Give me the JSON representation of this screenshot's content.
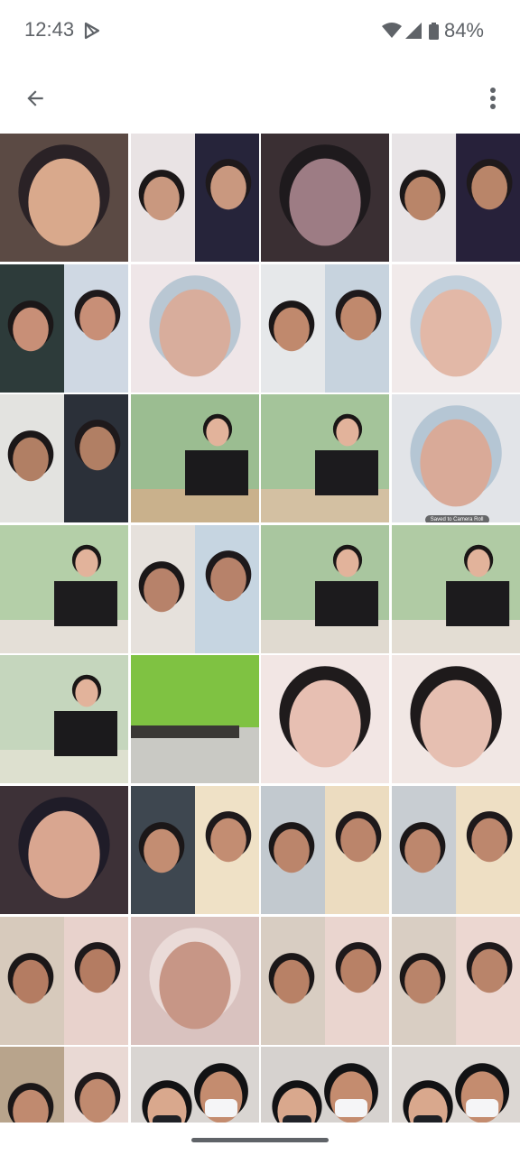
{
  "status_bar": {
    "time": "12:43",
    "battery": "84%",
    "icons": [
      "play-store-icon",
      "wifi-icon",
      "signal-icon",
      "battery-icon"
    ]
  },
  "app_bar": {
    "icons": [
      "arrow-back-icon",
      "more-vert-icon"
    ]
  },
  "photo_grid": {
    "columns": 4,
    "tiles": [
      {
        "desc": "selfie-glasses",
        "colors": [
          "#5b4a44",
          "#d9a98c",
          "#2a2226"
        ]
      },
      {
        "desc": "video-call-split",
        "colors": [
          "#e9e3e4",
          "#c9987f",
          "#26243a"
        ]
      },
      {
        "desc": "close-up-dark",
        "colors": [
          "#3a2f33",
          "#9d7c84",
          "#1e1a1d"
        ]
      },
      {
        "desc": "video-call-split",
        "colors": [
          "#e8e4e6",
          "#b98569",
          "#27213a"
        ]
      },
      {
        "desc": "video-call-split",
        "colors": [
          "#2d3b3a",
          "#c88f77",
          "#cfd8e3"
        ]
      },
      {
        "desc": "close-up-face",
        "colors": [
          "#efe6e8",
          "#d8ad9c",
          "#b9c7d3"
        ]
      },
      {
        "desc": "video-call-split",
        "colors": [
          "#e6e8ea",
          "#c0896d",
          "#c7d3de"
        ]
      },
      {
        "desc": "close-up-face",
        "colors": [
          "#f1eaea",
          "#e2b8a7",
          "#c2d0dc"
        ]
      },
      {
        "desc": "video-call-split",
        "colors": [
          "#e3e3e0",
          "#b17f64",
          "#2b3039"
        ]
      },
      {
        "desc": "restaurant",
        "colors": [
          "#9bbd91",
          "#1b1a1c",
          "#c9b18c"
        ]
      },
      {
        "desc": "restaurant",
        "colors": [
          "#a4c49a",
          "#1c1b1e",
          "#d3c0a2"
        ]
      },
      {
        "desc": "video-call-glasses",
        "colors": [
          "#e2e4e8",
          "#d9aa98",
          "#b5c6d4"
        ]
      },
      {
        "desc": "restaurant",
        "colors": [
          "#b4cfa8",
          "#1d1c1e",
          "#e4dfd7"
        ]
      },
      {
        "desc": "video-call-split",
        "colors": [
          "#e6e1dc",
          "#b7826a",
          "#c6d5e1"
        ]
      },
      {
        "desc": "restaurant",
        "colors": [
          "#a9c69f",
          "#1c1b1d",
          "#e0dad0"
        ]
      },
      {
        "desc": "restaurant",
        "colors": [
          "#b0cba4",
          "#1c1b1d",
          "#e3ddd3"
        ]
      },
      {
        "desc": "restaurant",
        "colors": [
          "#c5d6bd",
          "#1b1a1c",
          "#dde0cf"
        ]
      },
      {
        "desc": "green-screen-room",
        "colors": [
          "#7fc242",
          "#3a3835",
          "#c9c9c4"
        ]
      },
      {
        "desc": "peace-sign-selfie",
        "colors": [
          "#f2e6e4",
          "#e7bfb2",
          "#1f1b1c"
        ]
      },
      {
        "desc": "peace-sign-selfie",
        "colors": [
          "#f1e7e4",
          "#e6bfb1",
          "#1e1a1b"
        ]
      },
      {
        "desc": "close-up-face",
        "colors": [
          "#3d3137",
          "#d9a690",
          "#1f1c28"
        ]
      },
      {
        "desc": "video-call-split",
        "colors": [
          "#3e4750",
          "#c38d72",
          "#efe1c6"
        ]
      },
      {
        "desc": "video-call-split",
        "colors": [
          "#c2c9cf",
          "#bb856b",
          "#ecdcc0"
        ]
      },
      {
        "desc": "video-call-split",
        "colors": [
          "#c8cdd2",
          "#bd876d",
          "#eedfc4"
        ]
      },
      {
        "desc": "video-call-split",
        "colors": [
          "#d7cabc",
          "#b47c62",
          "#e8d2cc"
        ]
      },
      {
        "desc": "close-up-eye",
        "colors": [
          "#d9c2bf",
          "#c79686",
          "#eadbd8"
        ]
      },
      {
        "desc": "video-call-split",
        "colors": [
          "#d8cdc2",
          "#b88166",
          "#ead5cf"
        ]
      },
      {
        "desc": "video-call-split",
        "colors": [
          "#d9cec3",
          "#b9846a",
          "#ecd7d1"
        ]
      },
      {
        "desc": "video-call-split",
        "colors": [
          "#b8a48c",
          "#c08a6f",
          "#e9d9d4"
        ]
      },
      {
        "desc": "masked-couple",
        "colors": [
          "#d9d5d2",
          "#1f2126",
          "#f3e6a6"
        ]
      },
      {
        "desc": "masked-couple",
        "colors": [
          "#d6d2cf",
          "#202228",
          "#f3e7a8"
        ]
      },
      {
        "desc": "masked-couple",
        "colors": [
          "#dcd7d3",
          "#1e2025",
          "#f3e5a4"
        ]
      }
    ],
    "saved_to_camera_roll": "Saved to Camera Roll"
  },
  "colors": {
    "status_text": "#5f6368",
    "icon": "#5f6368",
    "background": "#ffffff"
  }
}
